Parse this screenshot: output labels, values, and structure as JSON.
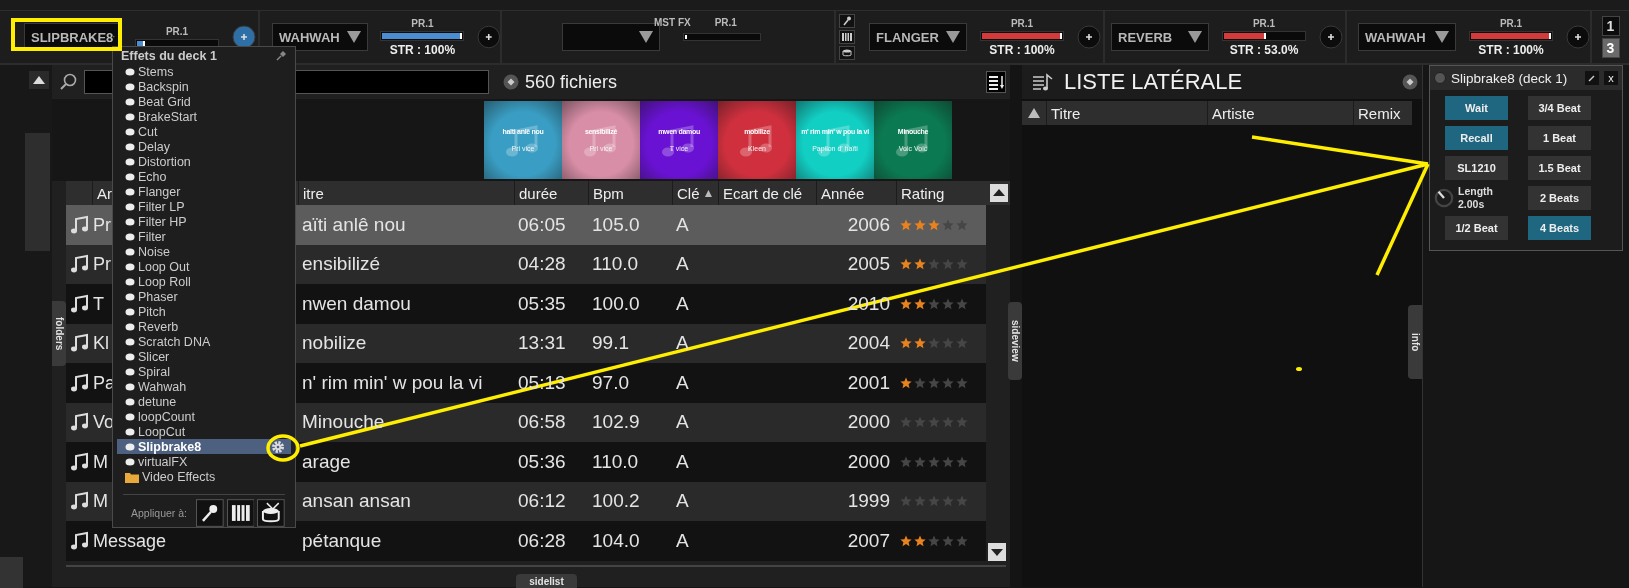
{
  "left_deck_fx": [
    {
      "effect": "SLIPBRAKE8",
      "param": "PR.1",
      "level": 0.1,
      "button_active": true
    },
    {
      "effect": "WAHWAH",
      "param": "PR.1",
      "level": 1.0,
      "strength": "STR : 100%",
      "button_active": false
    }
  ],
  "master_fx": {
    "label": "MST FX",
    "param": "PR.1",
    "level": 0.0
  },
  "right_deck_fx": [
    {
      "effect": "FLANGER",
      "param": "PR.1",
      "level": 1.0,
      "strength": "STR : 100%",
      "button_active": false
    },
    {
      "effect": "REVERB",
      "param": "PR.1",
      "level": 0.53,
      "strength": "STR : 53.0%",
      "button_active": false
    },
    {
      "effect": "WAHWAH",
      "param": "PR.1",
      "level": 1.0,
      "strength": "STR : 100%",
      "button_active": false
    }
  ],
  "deck_buttons": [
    {
      "label": "1",
      "selected": false
    },
    {
      "label": "3",
      "selected": true
    }
  ],
  "side_tabs": {
    "folders": "folders",
    "sideview": "sideview",
    "info": "info",
    "sidelist": "sidelist"
  },
  "browser": {
    "file_count": "560 fichiers",
    "covers": [
      {
        "title": "haïti anlê nou",
        "artist": "Pri vice",
        "color": "#3a9ec4"
      },
      {
        "title": "sensibilizé",
        "artist": "Pri vice",
        "color": "#d88ea6"
      },
      {
        "title": "mwen damou",
        "artist": "T vice",
        "color": "#6a12d4"
      },
      {
        "title": "mobilize",
        "artist": "Kleen",
        "color": "#d0303e"
      },
      {
        "title": "m' rim min' w pou la vi",
        "artist": "Papilon d' haïti",
        "color": "#12cfc4"
      },
      {
        "title": "Minouche",
        "artist": "Voic Voic",
        "color": "#0b7a52"
      }
    ],
    "columns": [
      {
        "label": "Ar"
      },
      {
        "label": "itre"
      },
      {
        "label": "durée"
      },
      {
        "label": "Bpm"
      },
      {
        "label": "Clé",
        "sort_arrow": "▲"
      },
      {
        "label": "Ecart de clé"
      },
      {
        "label": "Année"
      },
      {
        "label": "Rating"
      }
    ],
    "rows": [
      {
        "artist": "Pr",
        "title": "aïti anlê nou",
        "duration": "06:05",
        "bpm": "105.0",
        "key": "A",
        "year": "2006",
        "stars": 3,
        "selected": true
      },
      {
        "artist": "Pr",
        "title": "ensibilizé",
        "duration": "04:28",
        "bpm": "110.0",
        "key": "A",
        "year": "2005",
        "stars": 2,
        "selected": false
      },
      {
        "artist": "T",
        "title": "nwen damou",
        "duration": "05:35",
        "bpm": "100.0",
        "key": "A",
        "year": "2010",
        "stars": 2,
        "selected": false
      },
      {
        "artist": "Kl",
        "title": "nobilize",
        "duration": "13:31",
        "bpm": "99.1",
        "key": "A",
        "year": "2004",
        "stars": 2,
        "selected": false
      },
      {
        "artist": "Pa",
        "title": "n' rim min' w pou la vi",
        "duration": "05:13",
        "bpm": "97.0",
        "key": "A",
        "year": "2001",
        "stars": 1,
        "selected": false
      },
      {
        "artist": "Vo",
        "title": "Minouche",
        "duration": "06:58",
        "bpm": "102.9",
        "key": "A",
        "year": "2000",
        "stars": 0,
        "selected": false
      },
      {
        "artist": "M",
        "title": "arage",
        "duration": "05:36",
        "bpm": "110.0",
        "key": "A",
        "year": "2000",
        "stars": 0,
        "selected": false
      },
      {
        "artist": "M",
        "title": "ansan ansan",
        "duration": "06:12",
        "bpm": "100.2",
        "key": "A",
        "year": "1999",
        "stars": 0,
        "selected": false
      },
      {
        "artist": "Message",
        "title": "pétanque",
        "duration": "06:28",
        "bpm": "104.0",
        "key": "A",
        "year": "2007",
        "stars": 2,
        "selected": false
      }
    ]
  },
  "fx_menu": {
    "title": "Effets du deck 1",
    "items": [
      {
        "label": "Stems",
        "kind": "effect",
        "selected": false
      },
      {
        "label": "Backspin",
        "kind": "effect",
        "selected": false
      },
      {
        "label": "Beat Grid",
        "kind": "effect",
        "selected": false
      },
      {
        "label": "BrakeStart",
        "kind": "effect",
        "selected": false
      },
      {
        "label": "Cut",
        "kind": "effect",
        "selected": false
      },
      {
        "label": "Delay",
        "kind": "effect",
        "selected": false
      },
      {
        "label": "Distortion",
        "kind": "effect",
        "selected": false
      },
      {
        "label": "Echo",
        "kind": "effect",
        "selected": false
      },
      {
        "label": "Flanger",
        "kind": "effect",
        "selected": false
      },
      {
        "label": "Filter LP",
        "kind": "effect",
        "selected": false
      },
      {
        "label": "Filter HP",
        "kind": "effect",
        "selected": false
      },
      {
        "label": "Filter",
        "kind": "effect",
        "selected": false
      },
      {
        "label": "Noise",
        "kind": "effect",
        "selected": false
      },
      {
        "label": "Loop Out",
        "kind": "effect",
        "selected": false
      },
      {
        "label": "Loop Roll",
        "kind": "effect",
        "selected": false
      },
      {
        "label": "Phaser",
        "kind": "effect",
        "selected": false
      },
      {
        "label": "Pitch",
        "kind": "effect",
        "selected": false
      },
      {
        "label": "Reverb",
        "kind": "effect",
        "selected": false
      },
      {
        "label": "Scratch DNA",
        "kind": "effect",
        "selected": false
      },
      {
        "label": "Slicer",
        "kind": "effect",
        "selected": false
      },
      {
        "label": "Spiral",
        "kind": "effect",
        "selected": false
      },
      {
        "label": "Wahwah",
        "kind": "effect",
        "selected": false
      },
      {
        "label": "detune",
        "kind": "effect",
        "selected": false
      },
      {
        "label": "loopCount",
        "kind": "effect",
        "selected": false
      },
      {
        "label": "LoopCut",
        "kind": "effect",
        "selected": false
      },
      {
        "label": "Slipbrake8",
        "kind": "effect",
        "selected": true
      },
      {
        "label": "virtualFX",
        "kind": "effect",
        "selected": false
      },
      {
        "label": "Video Effects",
        "kind": "folder",
        "selected": false
      }
    ],
    "apply_label": "Appliquer à:"
  },
  "sidelist": {
    "title": "LISTE LATÉRALE",
    "columns": [
      "Titre",
      "Artiste",
      "Remix"
    ]
  },
  "fx_window": {
    "title": "Slipbrake8 (deck 1)",
    "close": "x",
    "left_controls": [
      {
        "kind": "button",
        "label": "Wait",
        "on": true
      },
      {
        "kind": "button",
        "label": "Recall",
        "on": true
      },
      {
        "kind": "button",
        "label": "SL1210",
        "on": false
      },
      {
        "kind": "knob",
        "label": "Length",
        "value": "2.00s"
      },
      {
        "kind": "button",
        "label": "1/2 Beat",
        "on": false
      }
    ],
    "right_controls": [
      {
        "kind": "button",
        "label": "3/4 Beat",
        "on": false
      },
      {
        "kind": "button",
        "label": "1 Beat",
        "on": false
      },
      {
        "kind": "button",
        "label": "1.5 Beat",
        "on": false
      },
      {
        "kind": "button",
        "label": "2 Beats",
        "on": false
      },
      {
        "kind": "button",
        "label": "4 Beats",
        "on": true
      }
    ]
  }
}
